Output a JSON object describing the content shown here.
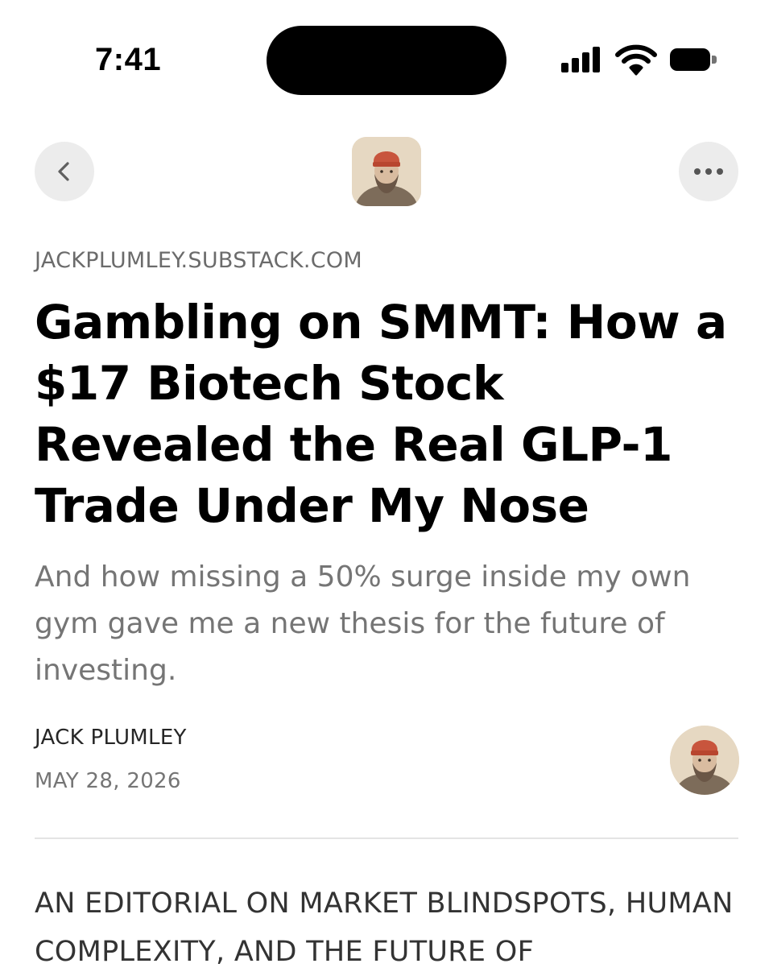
{
  "status_bar": {
    "time": "7:41",
    "icons": [
      "signal-icon",
      "wifi-icon",
      "battery-icon"
    ]
  },
  "nav": {
    "back_icon": "chevron-left-icon",
    "more_icon": "ellipsis-icon"
  },
  "article": {
    "domain": "JACKPLUMLEY.SUBSTACK.COM",
    "title": "Gambling on SMMT: How a $17 Biotech Stock Revealed the Real GLP-1 Trade Under My Nose",
    "subtitle": "And how missing a 50% surge inside my own gym gave me a new thesis for the future of investing.",
    "author": "JACK PLUMLEY",
    "date": "MAY 28, 2026",
    "body_start": "AN EDITORIAL ON MARKET BLINDSPOTS, HUMAN COMPLEXITY, AND THE FUTURE OF"
  },
  "colors": {
    "text": "#000000",
    "muted": "#757575",
    "button_bg": "#ececec",
    "divider": "#e4e4e4"
  }
}
